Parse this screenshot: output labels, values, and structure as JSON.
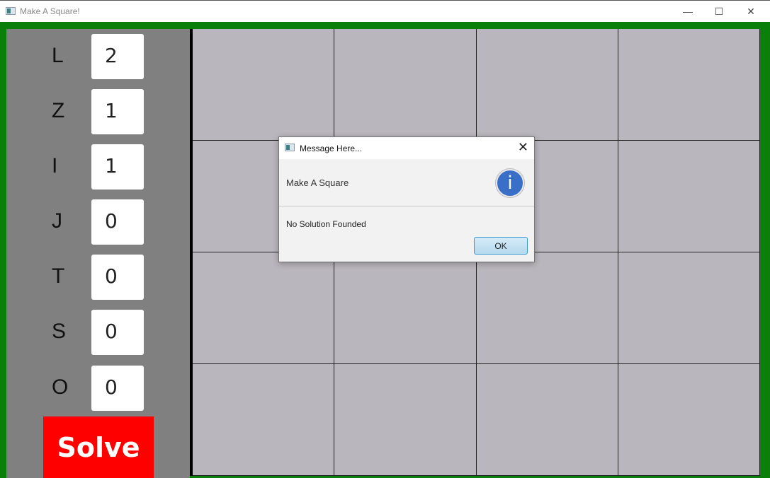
{
  "window": {
    "title": "Make A Square!",
    "minimize": "—",
    "maximize": "☐",
    "close": "✕"
  },
  "pieces": [
    {
      "label": "L",
      "count": "2"
    },
    {
      "label": "Z",
      "count": "1"
    },
    {
      "label": "I",
      "count": "1"
    },
    {
      "label": "J",
      "count": "0"
    },
    {
      "label": "T",
      "count": "0"
    },
    {
      "label": "S",
      "count": "0"
    },
    {
      "label": "O",
      "count": "0"
    }
  ],
  "solve_label": "Solve",
  "dialog": {
    "title": "Message Here...",
    "close": "✕",
    "header": "Make A Square",
    "info_glyph": "i",
    "message": "No Solution Founded",
    "ok_label": "OK"
  }
}
